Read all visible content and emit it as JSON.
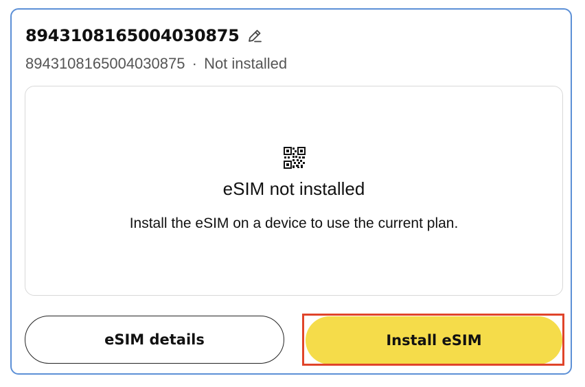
{
  "card": {
    "title": "8943108165004030875",
    "iccid": "8943108165004030875",
    "separator": "·",
    "status": "Not installed",
    "edit_icon": "pencil-edit-icon"
  },
  "panel": {
    "icon": "qr-code-icon",
    "heading": "eSIM not installed",
    "description": "Install the eSIM on a device to use the current plan."
  },
  "actions": {
    "details_label": "eSIM details",
    "install_label": "Install eSIM",
    "install_color": "#f5dc4a",
    "highlight_color": "#e0442a"
  },
  "colors": {
    "card_border": "#5b8fd6"
  }
}
